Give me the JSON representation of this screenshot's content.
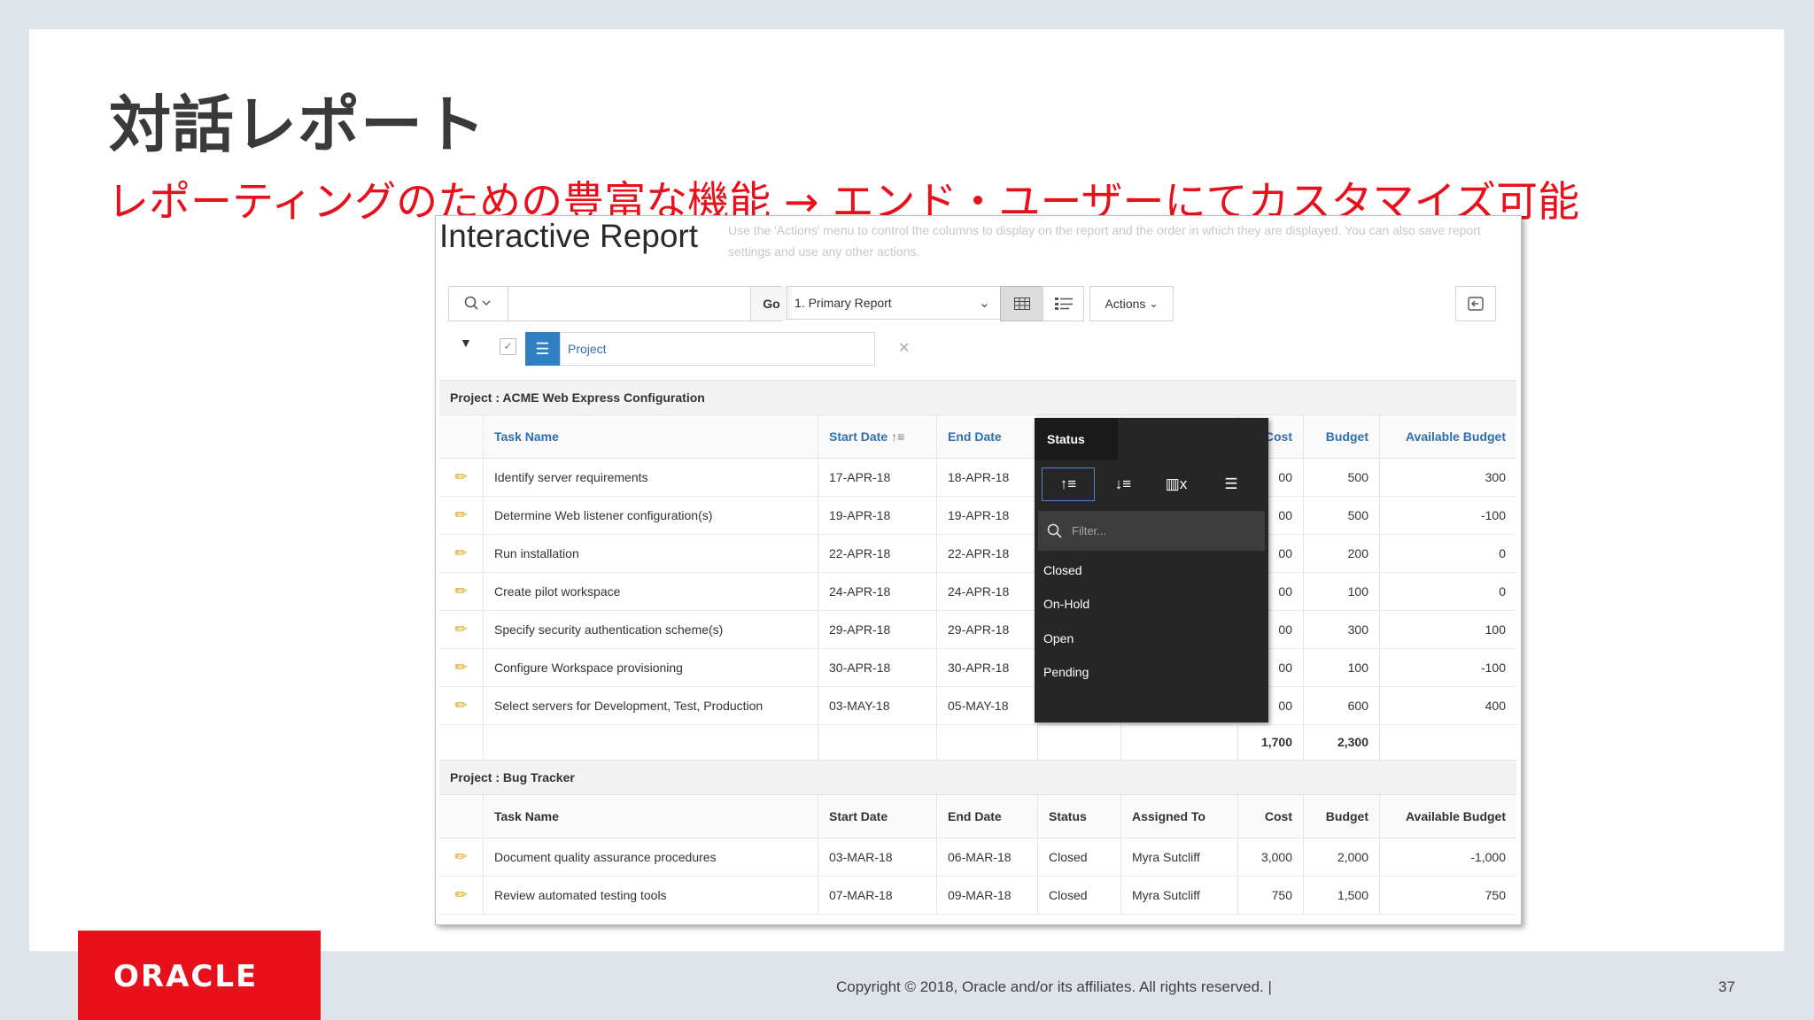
{
  "slide": {
    "title": "対話レポート",
    "subtitle": "レポーティングのための豊富な機能 → エンド・ユーザーにてカスタマイズ可能",
    "logo": "ORACLE",
    "copyright": "Copyright © 2018, Oracle and/or its affiliates. All rights reserved.  |",
    "page_number": "37"
  },
  "report": {
    "title": "Interactive Report",
    "ghost_text": "Use the 'Actions' menu to control the columns to display on the report and the order in which they are displayed. You can also save report settings and use any other actions.",
    "toolbar": {
      "search_placeholder": "",
      "go_label": "Go",
      "report_select": "1. Primary Report",
      "actions_label": "Actions"
    },
    "control_break": {
      "label": "Project"
    },
    "columns": [
      "Task Name",
      "Start Date",
      "End Date",
      "Status",
      "Assigned To",
      "Cost",
      "Budget",
      "Available Budget"
    ],
    "groups": [
      {
        "heading": "Project : ACME Web Express Configuration",
        "rows": [
          {
            "task": "Identify server requirements",
            "start": "17-APR-18",
            "end": "18-APR-18",
            "cost_tail": "00",
            "budget": "500",
            "available": "300"
          },
          {
            "task": "Determine Web listener configuration(s)",
            "start": "19-APR-18",
            "end": "19-APR-18",
            "cost_tail": "00",
            "budget": "500",
            "available": "-100"
          },
          {
            "task": "Run installation",
            "start": "22-APR-18",
            "end": "22-APR-18",
            "cost_tail": "00",
            "budget": "200",
            "available": "0"
          },
          {
            "task": "Create pilot workspace",
            "start": "24-APR-18",
            "end": "24-APR-18",
            "cost_tail": "00",
            "budget": "100",
            "available": "0"
          },
          {
            "task": "Specify security authentication scheme(s)",
            "start": "29-APR-18",
            "end": "29-APR-18",
            "cost_tail": "00",
            "budget": "300",
            "available": "100"
          },
          {
            "task": "Configure Workspace provisioning",
            "start": "30-APR-18",
            "end": "30-APR-18",
            "cost_tail": "00",
            "budget": "100",
            "available": "-100"
          },
          {
            "task": "Select servers for Development, Test, Production",
            "start": "03-MAY-18",
            "end": "05-MAY-18",
            "cost_tail": "00",
            "budget": "600",
            "available": "400"
          }
        ],
        "total_cost": "1,700",
        "total_budget": "2,300"
      },
      {
        "heading": "Project : Bug Tracker",
        "rows": [
          {
            "task": "Document quality assurance procedures",
            "start": "03-MAR-18",
            "end": "06-MAR-18",
            "status": "Closed",
            "assigned": "Myra Sutcliff",
            "cost": "3,000",
            "budget": "2,000",
            "available": "-1,000"
          },
          {
            "task": "Review automated testing tools",
            "start": "07-MAR-18",
            "end": "09-MAR-18",
            "status": "Closed",
            "assigned": "Myra Sutcliff",
            "cost": "750",
            "budget": "1,500",
            "available": "750"
          }
        ]
      }
    ],
    "status_menu": {
      "header": "Status",
      "filter_placeholder": "Filter...",
      "values": [
        "Closed",
        "On-Hold",
        "Open",
        "Pending"
      ],
      "icons": [
        "sort-ascending-icon",
        "sort-descending-icon",
        "hide-column-icon",
        "control-break-icon"
      ]
    }
  }
}
